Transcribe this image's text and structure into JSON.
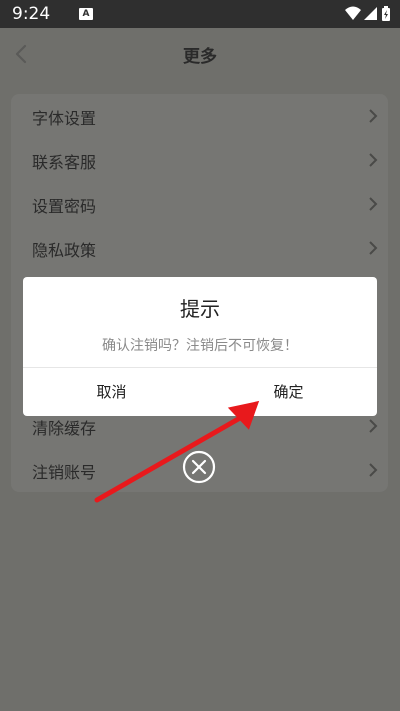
{
  "status_bar": {
    "time": "9:24",
    "sim_badge": "A",
    "icons": [
      "wifi-icon",
      "signal-icon",
      "battery-charging-icon"
    ]
  },
  "nav": {
    "title": "更多",
    "back_icon": "chevron-left-icon"
  },
  "menu": {
    "items": [
      {
        "label": "字体设置"
      },
      {
        "label": "联系客服"
      },
      {
        "label": "设置密码"
      },
      {
        "label": "隐私政策"
      },
      {
        "label": "清除缓存"
      },
      {
        "label": "注销账号"
      }
    ],
    "arrow_icon": "chevron-right-icon"
  },
  "dialog": {
    "title": "提示",
    "message": "确认注销吗？注销后不可恢复！",
    "cancel_label": "取消",
    "confirm_label": "确定"
  },
  "overlay": {
    "close_icon": "close-circle-icon",
    "annotation": "red-arrow-pointing-to-confirm"
  },
  "colors": {
    "overlay_bg": "#6f6f6b",
    "status_bar_bg": "#2f2f2f",
    "dialog_bg": "#ffffff",
    "message_text": "#8a8a8a",
    "annotation_arrow": "#e8191c"
  }
}
